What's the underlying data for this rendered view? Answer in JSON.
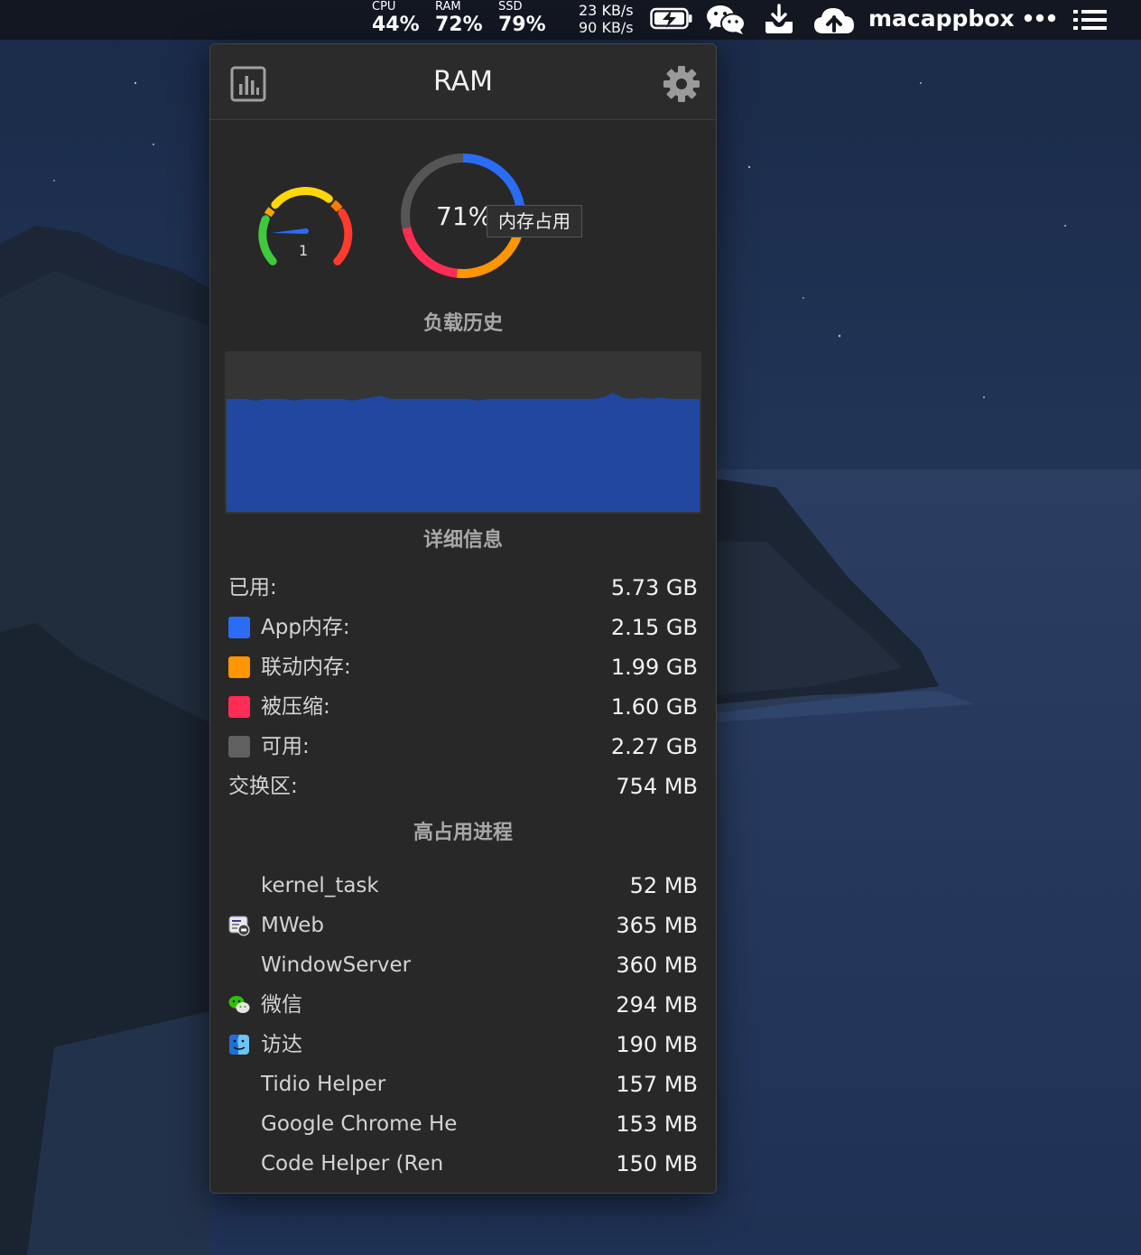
{
  "menubar": {
    "cpu": {
      "label": "CPU",
      "value": "44%"
    },
    "ram": {
      "label": "RAM",
      "value": "72%"
    },
    "ssd": {
      "label": "SSD",
      "value": "79%"
    },
    "net_up": "23 KB/s",
    "net_down": "90 KB/s",
    "brand": "macappbox",
    "icons": [
      "battery-charging-icon",
      "wechat-icon",
      "download-tray-icon",
      "cloud-icon",
      "more-dots-icon",
      "list-menu-icon"
    ]
  },
  "panel": {
    "title": "RAM",
    "icons": {
      "left": "bar-chart-icon",
      "right": "gear-icon"
    },
    "pressure_gauge": {
      "value": "1"
    },
    "donut": {
      "percent_label": "71%",
      "tooltip": "内存占用",
      "segments": [
        {
          "name": "App内存",
          "value": 2.15,
          "color": "#2b6cf5"
        },
        {
          "name": "联动内存",
          "value": 1.99,
          "color": "#ff9500"
        },
        {
          "name": "被压缩",
          "value": 1.6,
          "color": "#ff2d55"
        },
        {
          "name": "可用",
          "value": 2.27,
          "color": "#555555"
        }
      ]
    },
    "history": {
      "title": "负载历史",
      "fill_color": "#2147a0",
      "values": [
        71,
        71,
        71,
        70,
        71,
        71,
        71,
        70,
        71,
        71,
        71,
        71,
        71,
        70,
        71,
        72,
        73,
        71,
        71,
        71,
        71,
        71,
        71,
        71,
        71,
        71,
        70,
        71,
        71,
        71,
        71,
        71,
        71,
        71,
        71,
        71,
        71,
        71,
        71,
        72,
        75,
        72,
        71,
        72,
        71,
        72,
        71,
        71,
        71,
        71
      ]
    },
    "details": {
      "title": "详细信息",
      "rows": [
        {
          "label": "已用:",
          "value": "5.73 GB"
        },
        {
          "label": "App内存:",
          "value": "2.15 GB",
          "color": "#2b6cf5"
        },
        {
          "label": "联动内存:",
          "value": "1.99 GB",
          "color": "#ff9500"
        },
        {
          "label": "被压缩:",
          "value": "1.60 GB",
          "color": "#ff2d55"
        },
        {
          "label": "可用:",
          "value": "2.27 GB",
          "color": "#606060"
        },
        {
          "label": "交换区:",
          "value": "754 MB"
        }
      ]
    },
    "processes": {
      "title": "高占用进程",
      "rows": [
        {
          "name": "kernel_task",
          "value": "52 MB",
          "icon": ""
        },
        {
          "name": "MWeb",
          "value": "365 MB",
          "icon": "mweb-app-icon"
        },
        {
          "name": "WindowServer",
          "value": "360 MB",
          "icon": ""
        },
        {
          "name": "微信",
          "value": "294 MB",
          "icon": "wechat-app-icon"
        },
        {
          "name": "访达",
          "value": "190 MB",
          "icon": "finder-app-icon"
        },
        {
          "name": "Tidio Helper",
          "value": "157 MB",
          "icon": ""
        },
        {
          "name": "Google Chrome He",
          "value": "153 MB",
          "icon": ""
        },
        {
          "name": "Code Helper (Ren",
          "value": "150 MB",
          "icon": ""
        }
      ]
    }
  }
}
